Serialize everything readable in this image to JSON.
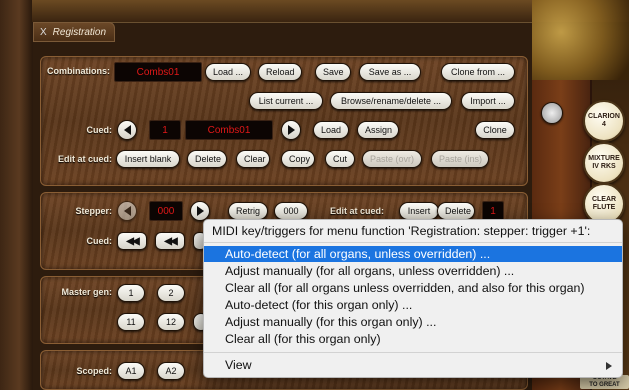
{
  "window": {
    "close": "X",
    "title": "Registration"
  },
  "combinations": {
    "label": "Combinations:",
    "current": "Combs01",
    "buttons": [
      "Load ...",
      "Reload",
      "Save",
      "Save as ...",
      "Clone from ..."
    ],
    "buttons2": [
      "List current ...",
      "Browse/rename/delete ...",
      "Import ..."
    ]
  },
  "cued": {
    "label": "Cued:",
    "number": "1",
    "name": "Combs01",
    "load": "Load",
    "assign": "Assign",
    "clone": "Clone"
  },
  "edit_at_cued": {
    "label": "Edit at cued:",
    "buttons": [
      "Insert blank",
      "Delete",
      "Clear",
      "Copy",
      "Cut",
      "Paste (ovr)",
      "Paste (ins)"
    ]
  },
  "stepper": {
    "label": "Stepper:",
    "value": "000",
    "retrig": "Retrig",
    "number": "000",
    "edit_label": "Edit at cued:",
    "insert": "Insert",
    "delete": "Delete",
    "digit": "1",
    "cued_label": "Cued:"
  },
  "master_gen": {
    "label": "Master gen:",
    "row1": [
      "1",
      "2"
    ],
    "row2": [
      "11",
      "12"
    ]
  },
  "scoped": {
    "label": "Scoped:",
    "buttons": [
      "A1",
      "A2"
    ]
  },
  "menu": {
    "header": "MIDI key/triggers for menu function 'Registration: stepper: trigger +1':",
    "items": [
      "Auto-detect (for all organs, unless overridden) ...",
      "Adjust manually (for all organs, unless overridden) ...",
      "Clear all (for all organs unless overridden, and also for this organ)",
      "Auto-detect (for this organ only) ...",
      "Adjust manually (for this organ only) ...",
      "Clear all (for this organ only)"
    ],
    "view": "View"
  },
  "organ_stops": [
    "CLARION\n4",
    "MIXTURE\nIV RKS",
    "CLEAR\nFLUTE",
    "OCTAVE\nTO GREAT"
  ]
}
